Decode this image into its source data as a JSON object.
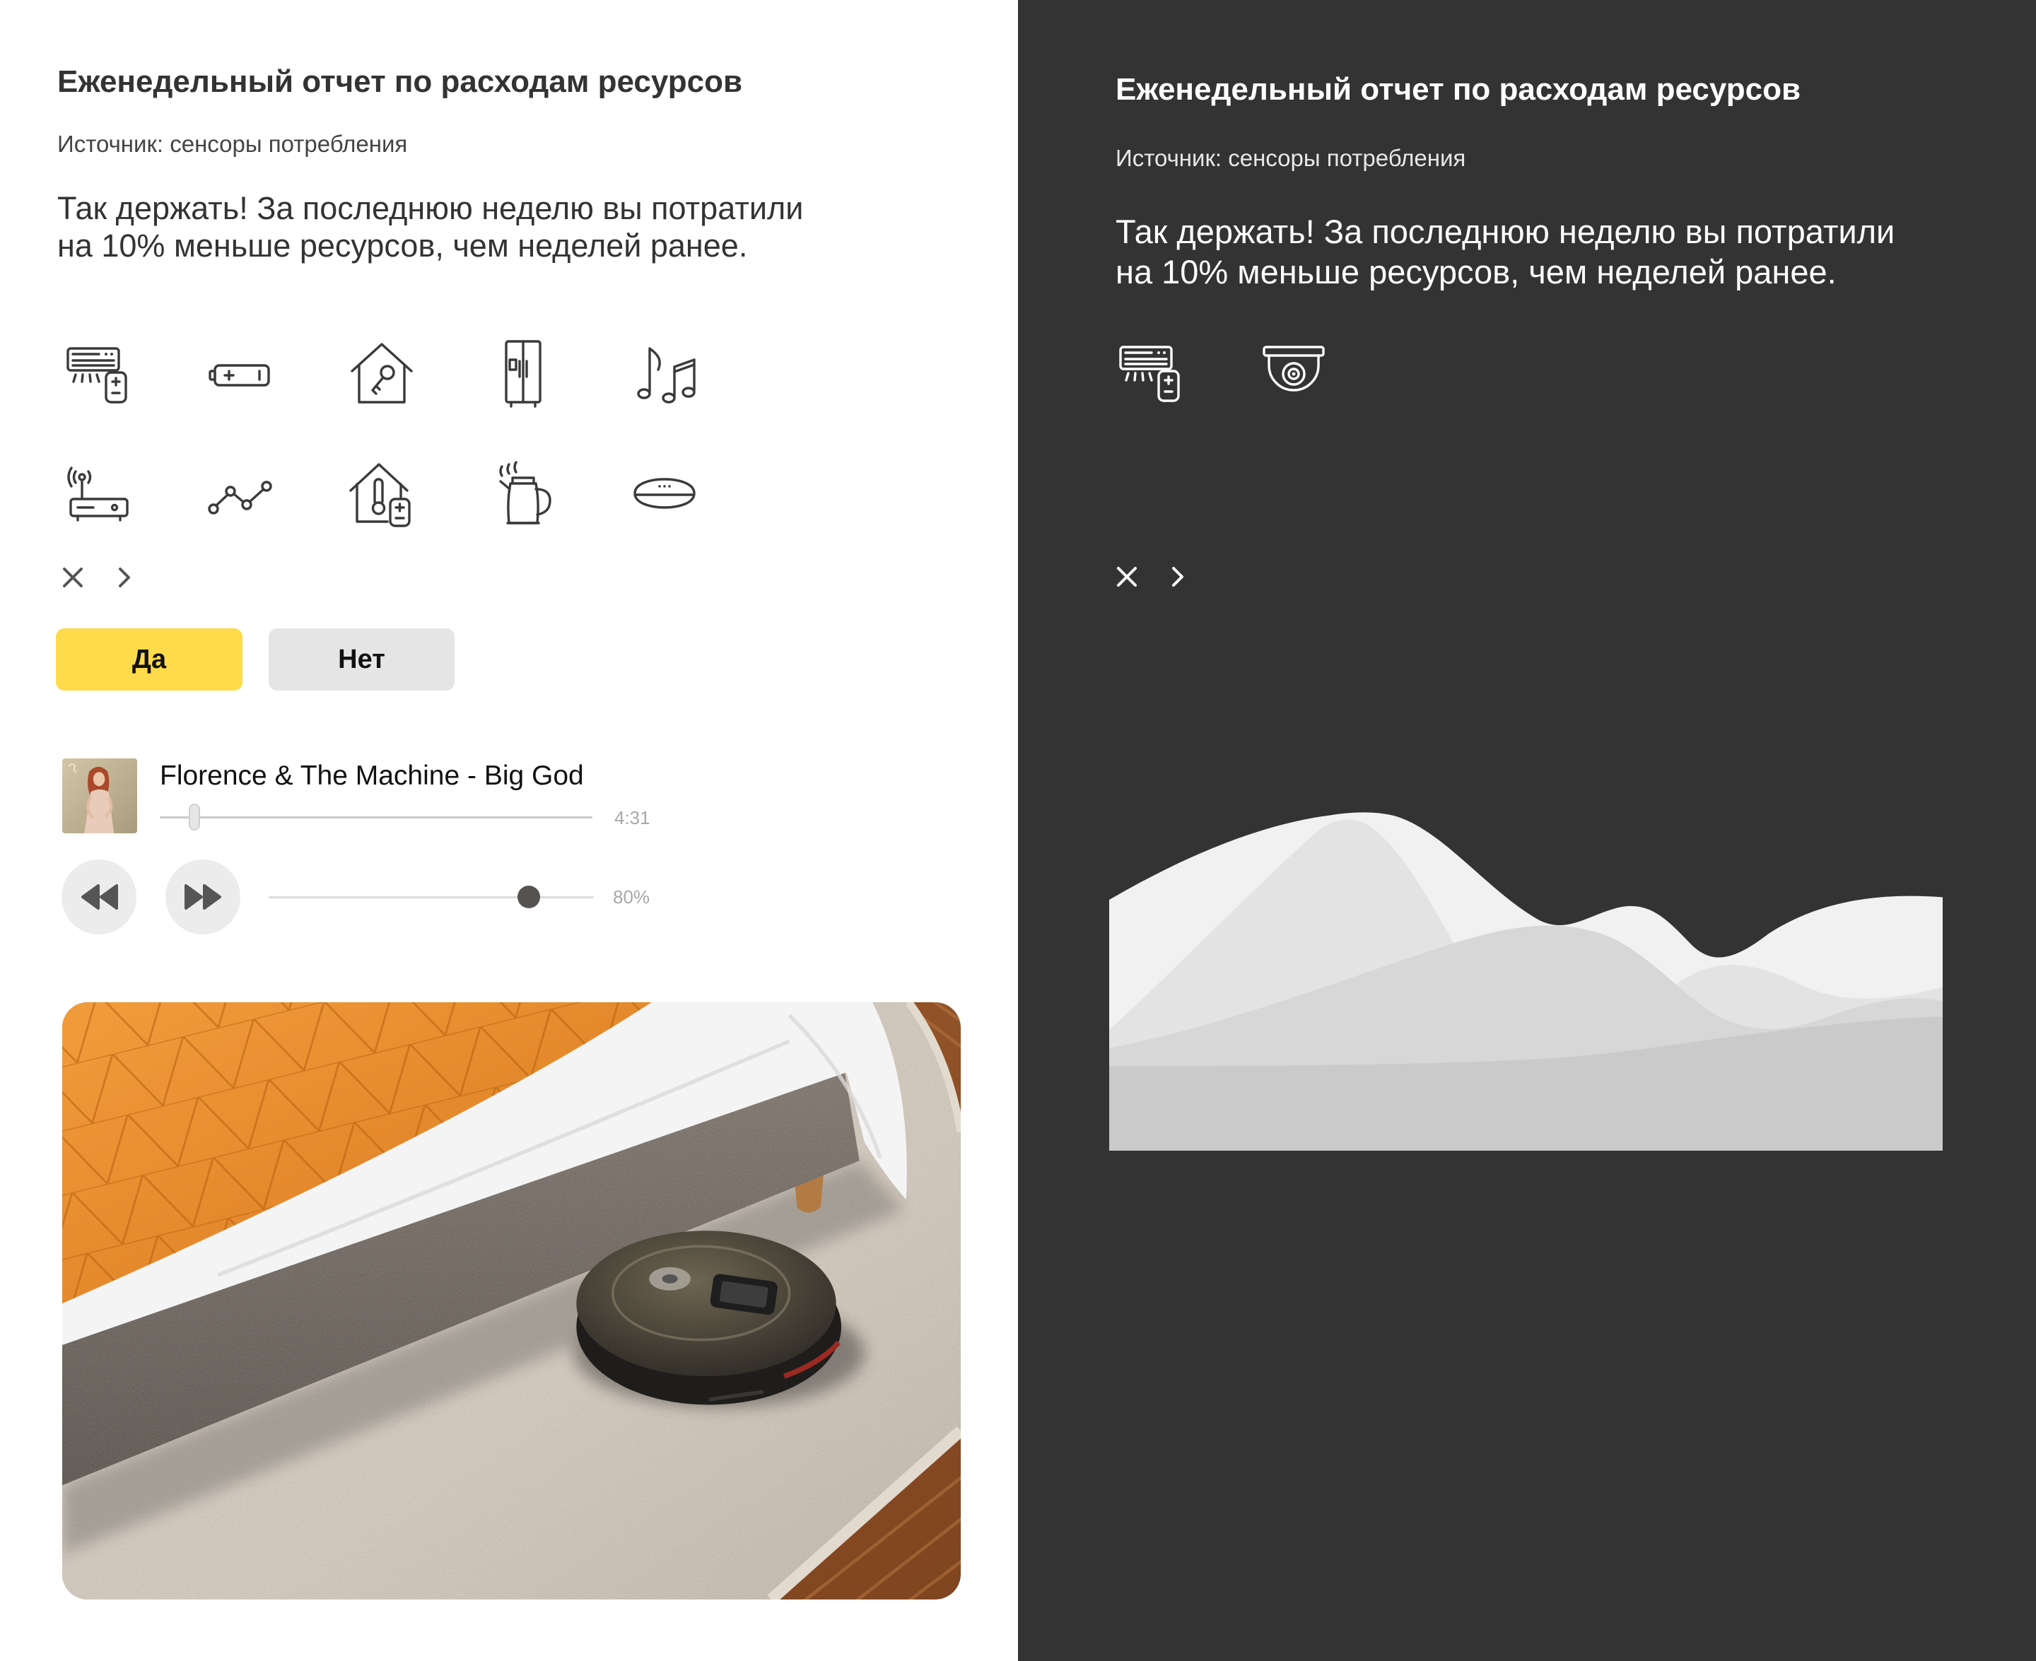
{
  "colors": {
    "accent_yellow": "#fedb4a",
    "dark_panel": "#333333",
    "button_gray": "#e5e5e5"
  },
  "left_panel": {
    "title": "Еженедельный отчет по расходам ресурсов",
    "source": "Источник: сенсоры потребления",
    "message": [
      "Так держать! За последнюю неделю вы потратили",
      "на 10% меньше ресурсов, чем неделей ранее."
    ],
    "device_icons": [
      "air-conditioner-remote-icon",
      "battery-icon",
      "house-key-icon",
      "refrigerator-icon",
      "music-notes-icon",
      "router-icon",
      "line-graph-icon",
      "house-thermometer-remote-icon",
      "kettle-icon",
      "smart-speaker-icon"
    ],
    "close_icon": "close-icon",
    "next_icon": "chevron-right-icon",
    "buttons": {
      "yes": "Да",
      "no": "Нет"
    },
    "player": {
      "track_title": "Florence & The Machine - Big God",
      "duration": "4:31",
      "progress": 0.08,
      "volume": 0.8,
      "volume_label": "80%",
      "rewind_icon": "rewind-icon",
      "forward_icon": "fast-forward-icon"
    }
  },
  "right_panel": {
    "title": "Еженедельный отчет по расходам ресурсов",
    "source": "Источник: сенсоры потребления",
    "message": [
      "Так держать! За последнюю неделю вы потратили",
      "на 10% меньше ресурсов, чем неделей ранее."
    ],
    "device_icons": [
      "air-conditioner-remote-icon",
      "security-camera-icon"
    ],
    "close_icon": "close-icon",
    "next_icon": "chevron-right-icon"
  }
}
